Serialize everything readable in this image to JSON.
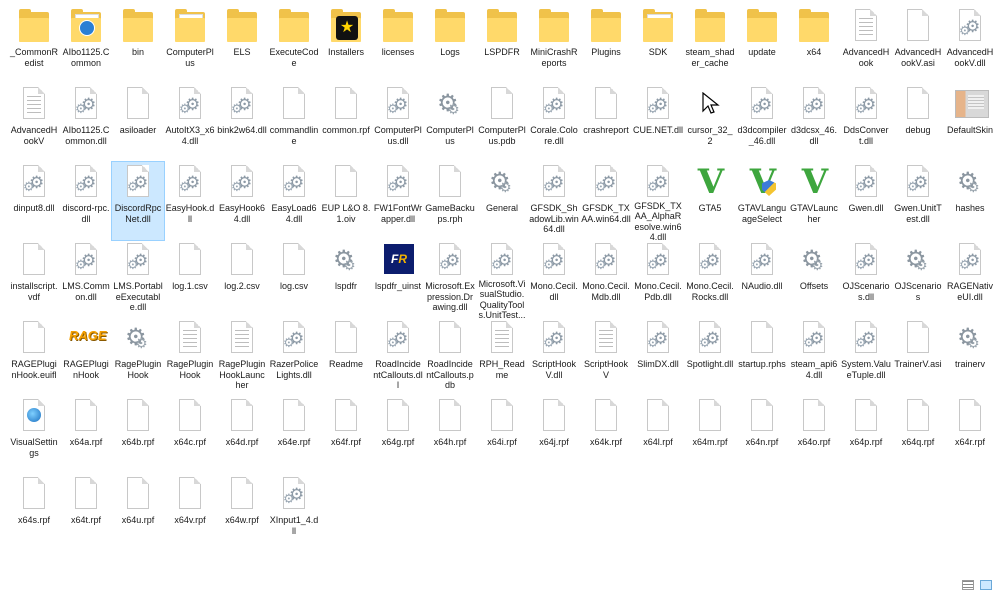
{
  "files": [
    {
      "label": "_CommonRedist",
      "icon": "folder"
    },
    {
      "label": "AIbo1125.Common",
      "icon": "folder-globe"
    },
    {
      "label": "bin",
      "icon": "folder"
    },
    {
      "label": "ComputerPlus",
      "icon": "folder-doc"
    },
    {
      "label": "ELS",
      "icon": "folder"
    },
    {
      "label": "ExecuteCode",
      "icon": "folder"
    },
    {
      "label": "Installers",
      "icon": "folder-star"
    },
    {
      "label": "licenses",
      "icon": "folder"
    },
    {
      "label": "Logs",
      "icon": "folder"
    },
    {
      "label": "LSPDFR",
      "icon": "folder"
    },
    {
      "label": "MiniCrashReports",
      "icon": "folder"
    },
    {
      "label": "Plugins",
      "icon": "folder"
    },
    {
      "label": "SDK",
      "icon": "folder-doc"
    },
    {
      "label": "steam_shader_cache",
      "icon": "folder"
    },
    {
      "label": "update",
      "icon": "folder"
    },
    {
      "label": "x64",
      "icon": "folder"
    },
    {
      "label": "AdvancedHook",
      "icon": "file-lines"
    },
    {
      "label": "AdvancedHookV.asi",
      "icon": "file"
    },
    {
      "label": "AdvancedHookV.dll",
      "icon": "file-gear"
    },
    {
      "label": "AdvancedHookV",
      "icon": "file-lines"
    },
    {
      "label": "AIbo1125.Common.dll",
      "icon": "file-gear"
    },
    {
      "label": "asiloader",
      "icon": "file"
    },
    {
      "label": "AutoItX3_x64.dll",
      "icon": "file-gear"
    },
    {
      "label": "bink2w64.dll",
      "icon": "file-gear"
    },
    {
      "label": "commandline",
      "icon": "file"
    },
    {
      "label": "common.rpf",
      "icon": "file"
    },
    {
      "label": "ComputerPlus.dll",
      "icon": "file-gear"
    },
    {
      "label": "ComputerPlus",
      "icon": "gear"
    },
    {
      "label": "ComputerPlus.pdb",
      "icon": "file"
    },
    {
      "label": "Corale.Colore.dll",
      "icon": "file-gear"
    },
    {
      "label": "crashreport",
      "icon": "file"
    },
    {
      "label": "CUE.NET.dll",
      "icon": "file-gear"
    },
    {
      "label": "cursor_32_2",
      "icon": "cursor"
    },
    {
      "label": "d3dcompiler_46.dll",
      "icon": "file-gear"
    },
    {
      "label": "d3dcsx_46.dll",
      "icon": "file-gear"
    },
    {
      "label": "DdsConvert.dll",
      "icon": "file-gear"
    },
    {
      "label": "debug",
      "icon": "file"
    },
    {
      "label": "DefaultSkin",
      "icon": "skin"
    },
    {
      "label": "dinput8.dll",
      "icon": "file-gear"
    },
    {
      "label": "discord-rpc.dll",
      "icon": "file-gear"
    },
    {
      "label": "DiscordRpcNet.dll",
      "icon": "file-gear",
      "selected": true
    },
    {
      "label": "EasyHook.dll",
      "icon": "file-gear"
    },
    {
      "label": "EasyHook64.dll",
      "icon": "file-gear"
    },
    {
      "label": "EasyLoad64.dll",
      "icon": "file-gear"
    },
    {
      "label": "EUP L&O 8.1.oiv",
      "icon": "file"
    },
    {
      "label": "FW1FontWrapper.dll",
      "icon": "file-gear"
    },
    {
      "label": "GameBackups.rph",
      "icon": "file"
    },
    {
      "label": "General",
      "icon": "gear"
    },
    {
      "label": "GFSDK_ShadowLib.win64.dll",
      "icon": "file-gear"
    },
    {
      "label": "GFSDK_TXAA.win64.dll",
      "icon": "file-gear"
    },
    {
      "label": "GFSDK_TXAA_AlphaResolve.win64.dll",
      "icon": "file-gear"
    },
    {
      "label": "GTA5",
      "icon": "gta"
    },
    {
      "label": "GTAVLanguageSelect",
      "icon": "gta-shield"
    },
    {
      "label": "GTAVLauncher",
      "icon": "gta"
    },
    {
      "label": "Gwen.dll",
      "icon": "file-gear"
    },
    {
      "label": "Gwen.UnitTest.dll",
      "icon": "file-gear"
    },
    {
      "label": "hashes",
      "icon": "gear"
    },
    {
      "label": "installscript.vdf",
      "icon": "file"
    },
    {
      "label": "LMS.Common.dll",
      "icon": "file-gear"
    },
    {
      "label": "LMS.PortableExecutable.dll",
      "icon": "file-gear"
    },
    {
      "label": "log.1.csv",
      "icon": "file"
    },
    {
      "label": "log.2.csv",
      "icon": "file"
    },
    {
      "label": "log.csv",
      "icon": "file"
    },
    {
      "label": "lspdfr",
      "icon": "gear"
    },
    {
      "label": "lspdfr_uinst",
      "icon": "lspdfr"
    },
    {
      "label": "Microsoft.Expression.Drawing.dll",
      "icon": "file-gear"
    },
    {
      "label": "Microsoft.VisualStudio.QualityTools.UnitTest...",
      "icon": "file-gear"
    },
    {
      "label": "Mono.Cecil.dll",
      "icon": "file-gear"
    },
    {
      "label": "Mono.Cecil.Mdb.dll",
      "icon": "file-gear"
    },
    {
      "label": "Mono.Cecil.Pdb.dll",
      "icon": "file-gear"
    },
    {
      "label": "Mono.Cecil.Rocks.dll",
      "icon": "file-gear"
    },
    {
      "label": "NAudio.dll",
      "icon": "file-gear"
    },
    {
      "label": "Offsets",
      "icon": "gear"
    },
    {
      "label": "OJScenarios.dll",
      "icon": "file-gear"
    },
    {
      "label": "OJScenarios",
      "icon": "gear"
    },
    {
      "label": "RAGENativeUI.dll",
      "icon": "file-gear"
    },
    {
      "label": "RAGEPluginHook.euifl",
      "icon": "file"
    },
    {
      "label": "RAGEPluginHook",
      "icon": "rage"
    },
    {
      "label": "RagePluginHook",
      "icon": "gear"
    },
    {
      "label": "RagePluginHook",
      "icon": "file-lines"
    },
    {
      "label": "RagePluginHookLauncher",
      "icon": "file-lines"
    },
    {
      "label": "RazerPoliceLights.dll",
      "icon": "file-gear"
    },
    {
      "label": "Readme",
      "icon": "file"
    },
    {
      "label": "RoadIncidentCallouts.dll",
      "icon": "file-gear"
    },
    {
      "label": "RoadIncidentCallouts.pdb",
      "icon": "file"
    },
    {
      "label": "RPH_Readme",
      "icon": "file-lines"
    },
    {
      "label": "ScriptHookV.dll",
      "icon": "file-gear"
    },
    {
      "label": "ScriptHookV",
      "icon": "file-lines"
    },
    {
      "label": "SlimDX.dll",
      "icon": "file-gear"
    },
    {
      "label": "Spotlight.dll",
      "icon": "file-gear"
    },
    {
      "label": "startup.rphs",
      "icon": "file"
    },
    {
      "label": "steam_api64.dll",
      "icon": "file-gear"
    },
    {
      "label": "System.ValueTuple.dll",
      "icon": "file-gear"
    },
    {
      "label": "TrainerV.asi",
      "icon": "file"
    },
    {
      "label": "trainerv",
      "icon": "gear"
    },
    {
      "label": "VisualSettings",
      "icon": "file-globe"
    },
    {
      "label": "x64a.rpf",
      "icon": "file"
    },
    {
      "label": "x64b.rpf",
      "icon": "file"
    },
    {
      "label": "x64c.rpf",
      "icon": "file"
    },
    {
      "label": "x64d.rpf",
      "icon": "file"
    },
    {
      "label": "x64e.rpf",
      "icon": "file"
    },
    {
      "label": "x64f.rpf",
      "icon": "file"
    },
    {
      "label": "x64g.rpf",
      "icon": "file"
    },
    {
      "label": "x64h.rpf",
      "icon": "file"
    },
    {
      "label": "x64i.rpf",
      "icon": "file"
    },
    {
      "label": "x64j.rpf",
      "icon": "file"
    },
    {
      "label": "x64k.rpf",
      "icon": "file"
    },
    {
      "label": "x64l.rpf",
      "icon": "file"
    },
    {
      "label": "x64m.rpf",
      "icon": "file"
    },
    {
      "label": "x64n.rpf",
      "icon": "file"
    },
    {
      "label": "x64o.rpf",
      "icon": "file"
    },
    {
      "label": "x64p.rpf",
      "icon": "file"
    },
    {
      "label": "x64q.rpf",
      "icon": "file"
    },
    {
      "label": "x64r.rpf",
      "icon": "file"
    },
    {
      "label": "x64s.rpf",
      "icon": "file"
    },
    {
      "label": "x64t.rpf",
      "icon": "file"
    },
    {
      "label": "x64u.rpf",
      "icon": "file"
    },
    {
      "label": "x64v.rpf",
      "icon": "file"
    },
    {
      "label": "x64w.rpf",
      "icon": "file"
    },
    {
      "label": "XInput1_4.dll",
      "icon": "file-gear"
    }
  ],
  "view_buttons": [
    {
      "name": "details-view-icon",
      "active": false
    },
    {
      "name": "large-icons-view-icon",
      "active": true
    }
  ],
  "colors": {
    "selection": "#cce8ff",
    "folder": "#ffd96a",
    "gta_green": "#3ea63e"
  }
}
